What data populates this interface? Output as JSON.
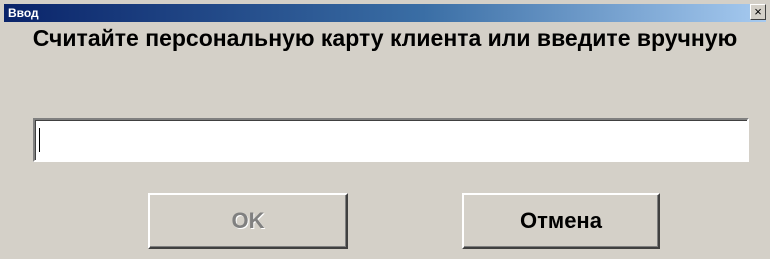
{
  "window": {
    "title": "Ввод",
    "close_glyph": "×"
  },
  "prompt": {
    "text": "Считайте персональную карту клиента или введите вручную"
  },
  "input": {
    "value": "",
    "placeholder": ""
  },
  "buttons": {
    "ok_label": "OK",
    "ok_enabled": false,
    "cancel_label": "Отмена"
  },
  "colors": {
    "title_start": "#0a246a",
    "title_end": "#a6caf0",
    "face": "#d4d0c8",
    "disabled_text": "#808080"
  }
}
